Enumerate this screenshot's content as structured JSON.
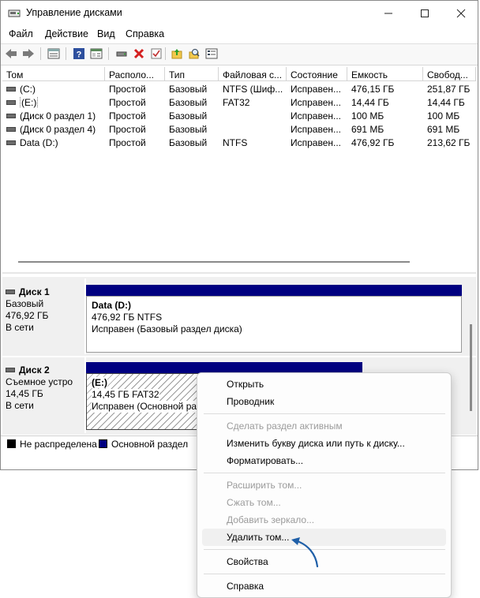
{
  "window": {
    "title": "Управление дисками"
  },
  "menu": [
    "Файл",
    "Действие",
    "Вид",
    "Справка"
  ],
  "columns": [
    "Том",
    "Располо...",
    "Тип",
    "Файловая с...",
    "Состояние",
    "Емкость",
    "Свобод..."
  ],
  "volumes": [
    [
      "(C:)",
      "Простой",
      "Базовый",
      "NTFS (Шиф...",
      "Исправен...",
      "476,15 ГБ",
      "251,87 ГБ"
    ],
    [
      "(E:)",
      "Простой",
      "Базовый",
      "FAT32",
      "Исправен...",
      "14,44 ГБ",
      "14,44 ГБ"
    ],
    [
      "(Диск 0 раздел 1)",
      "Простой",
      "Базовый",
      "",
      "Исправен...",
      "100 МБ",
      "100 МБ"
    ],
    [
      "(Диск 0 раздел 4)",
      "Простой",
      "Базовый",
      "",
      "Исправен...",
      "691 МБ",
      "691 МБ"
    ],
    [
      "Data (D:)",
      "Простой",
      "Базовый",
      "NTFS",
      "Исправен...",
      "476,92 ГБ",
      "213,62 ГБ"
    ]
  ],
  "disks": [
    {
      "name": "Диск 1",
      "type": "Базовый",
      "size": "476,92 ГБ",
      "status": "В сети",
      "partition": {
        "name": "Data  (D:)",
        "detail": "476,92 ГБ NTFS",
        "status": "Исправен (Базовый раздел диска)"
      }
    },
    {
      "name": "Диск 2",
      "type": "Съемное устро",
      "size": "14,45 ГБ",
      "status": "В сети",
      "partition": {
        "name": "(E:)",
        "detail": "14,45 ГБ FAT32",
        "status": "Исправен (Основной раз"
      }
    }
  ],
  "legend": [
    {
      "label": "Не распределена",
      "color": "#000000"
    },
    {
      "label": "Основной раздел",
      "color": "#000080"
    }
  ],
  "context_menu": [
    {
      "label": "Открыть",
      "enabled": true
    },
    {
      "label": "Проводник",
      "enabled": true
    },
    {
      "label": "Сделать раздел активным",
      "enabled": false
    },
    {
      "label": "Изменить букву диска или путь к диску...",
      "enabled": true
    },
    {
      "label": "Форматировать...",
      "enabled": true
    },
    {
      "label": "Расширить том...",
      "enabled": false
    },
    {
      "label": "Сжать том...",
      "enabled": false
    },
    {
      "label": "Добавить зеркало...",
      "enabled": false
    },
    {
      "label": "Удалить том...",
      "enabled": true,
      "highlighted": true
    },
    {
      "label": "Свойства",
      "enabled": true
    },
    {
      "label": "Справка",
      "enabled": true
    }
  ],
  "icons": {
    "window": [
      "minimize-icon",
      "maximize-icon",
      "close-icon"
    ],
    "toolbar": [
      "back-icon",
      "forward-icon",
      "disk-list-icon",
      "help-icon",
      "console-icon",
      "connect-icon",
      "delete-icon",
      "check-icon",
      "folder-up-icon",
      "search-icon",
      "properties-icon"
    ]
  },
  "colors": {
    "primary_partition": "#000080",
    "arrow": "#1f5fa8",
    "delete_icon": "#d42020"
  }
}
